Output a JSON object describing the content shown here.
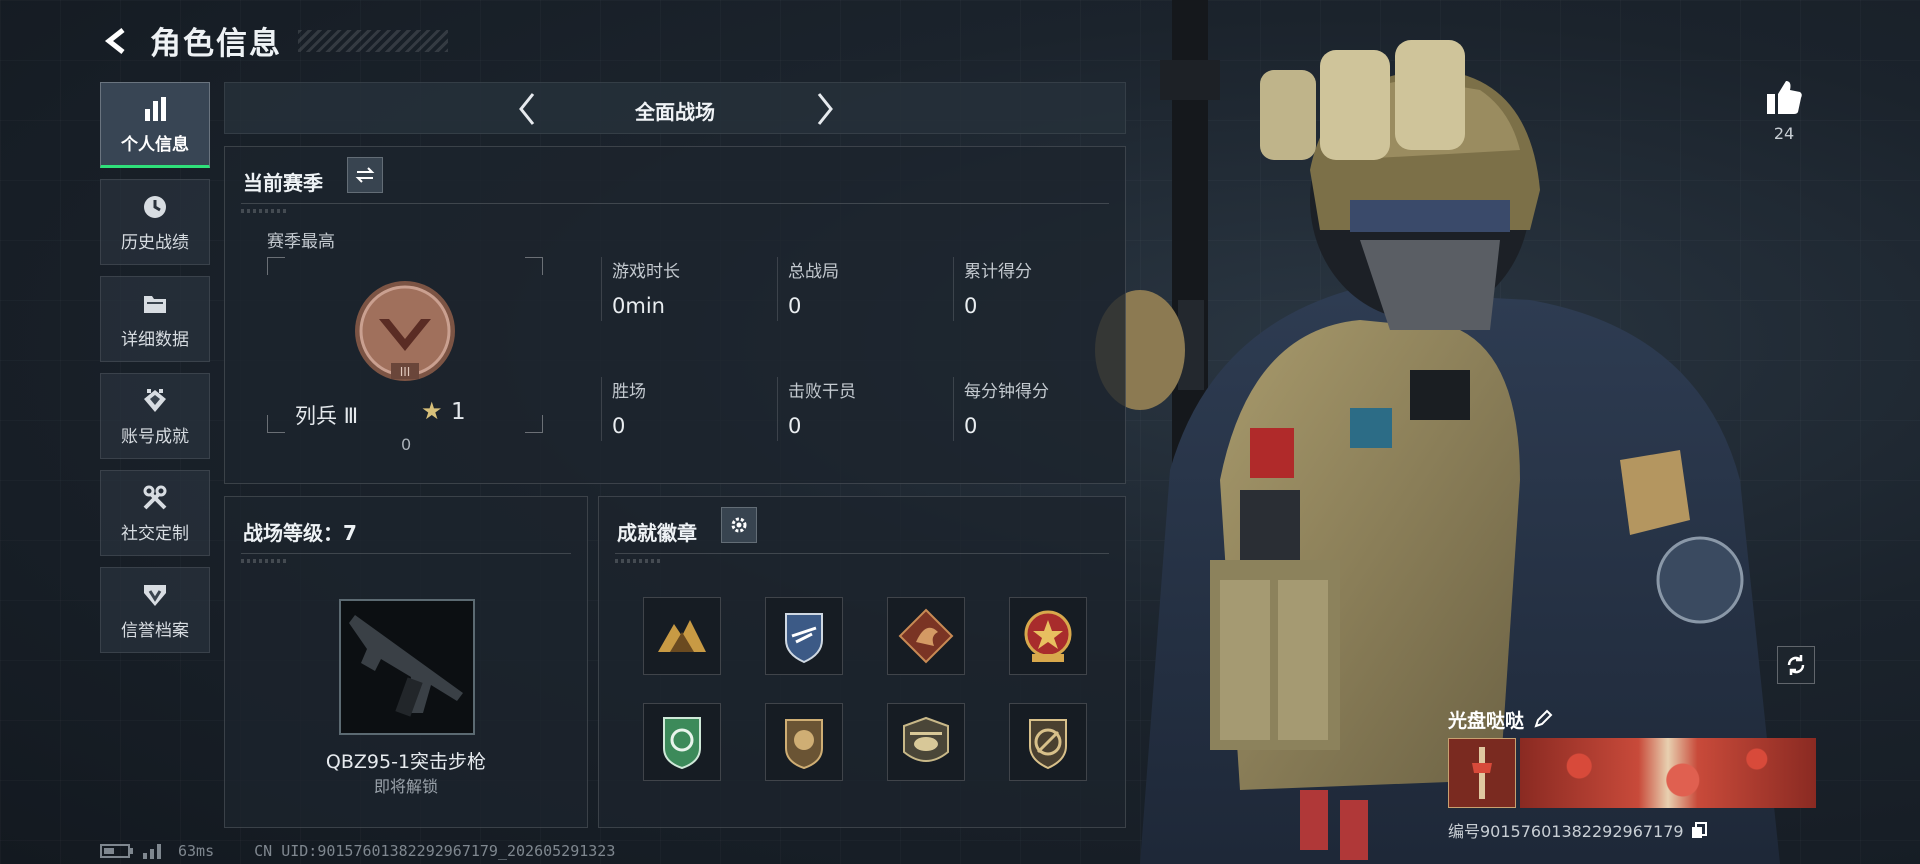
{
  "header": {
    "title": "角色信息"
  },
  "nav": {
    "items": [
      {
        "label": "个人信息",
        "icon": "bar-chart-icon",
        "active": true
      },
      {
        "label": "历史战绩",
        "icon": "history-clock-icon",
        "active": false
      },
      {
        "label": "详细数据",
        "icon": "folder-icon",
        "active": false
      },
      {
        "label": "账号成就",
        "icon": "achievement-icon",
        "active": false
      },
      {
        "label": "社交定制",
        "icon": "tools-icon",
        "active": false
      },
      {
        "label": "信誉档案",
        "icon": "credibility-icon",
        "active": false
      }
    ]
  },
  "mode": {
    "title": "全面战场"
  },
  "season": {
    "title": "当前赛季",
    "peak_label": "赛季最高",
    "rank_name": "列兵 Ⅲ",
    "rank_stars": "1",
    "rank_points": "0",
    "stats": [
      {
        "label": "游戏时长",
        "value": "0min"
      },
      {
        "label": "总战局",
        "value": "0"
      },
      {
        "label": "累计得分",
        "value": "0"
      },
      {
        "label": "胜场",
        "value": "0"
      },
      {
        "label": "击败干员",
        "value": "0"
      },
      {
        "label": "每分钟得分",
        "value": "0"
      }
    ]
  },
  "level": {
    "title": "战场等级：7",
    "weapon_name": "QBZ95-1突击步枪",
    "weapon_status": "即将解锁"
  },
  "badges": {
    "title": "成就徽章",
    "items": [
      {
        "icon": "badge-mountain-icon"
      },
      {
        "icon": "badge-shield-wing-icon"
      },
      {
        "icon": "badge-dragon-icon"
      },
      {
        "icon": "badge-star-emblem-icon"
      },
      {
        "icon": "badge-green-shield-icon"
      },
      {
        "icon": "badge-lion-shield-icon"
      },
      {
        "icon": "badge-helicopter-icon"
      },
      {
        "icon": "badge-blade-shield-icon"
      }
    ]
  },
  "profile": {
    "likes": "24",
    "player_name": "光盘哒哒",
    "player_id": "编号90157601382292967179"
  },
  "status": {
    "ping": "63ms",
    "uid": "CN UID:90157601382292967179_202605291323"
  },
  "colors": {
    "accent_green": "#2fe07a",
    "rank_bronze": "#a0705c",
    "star_gold": "#d8c07a"
  }
}
